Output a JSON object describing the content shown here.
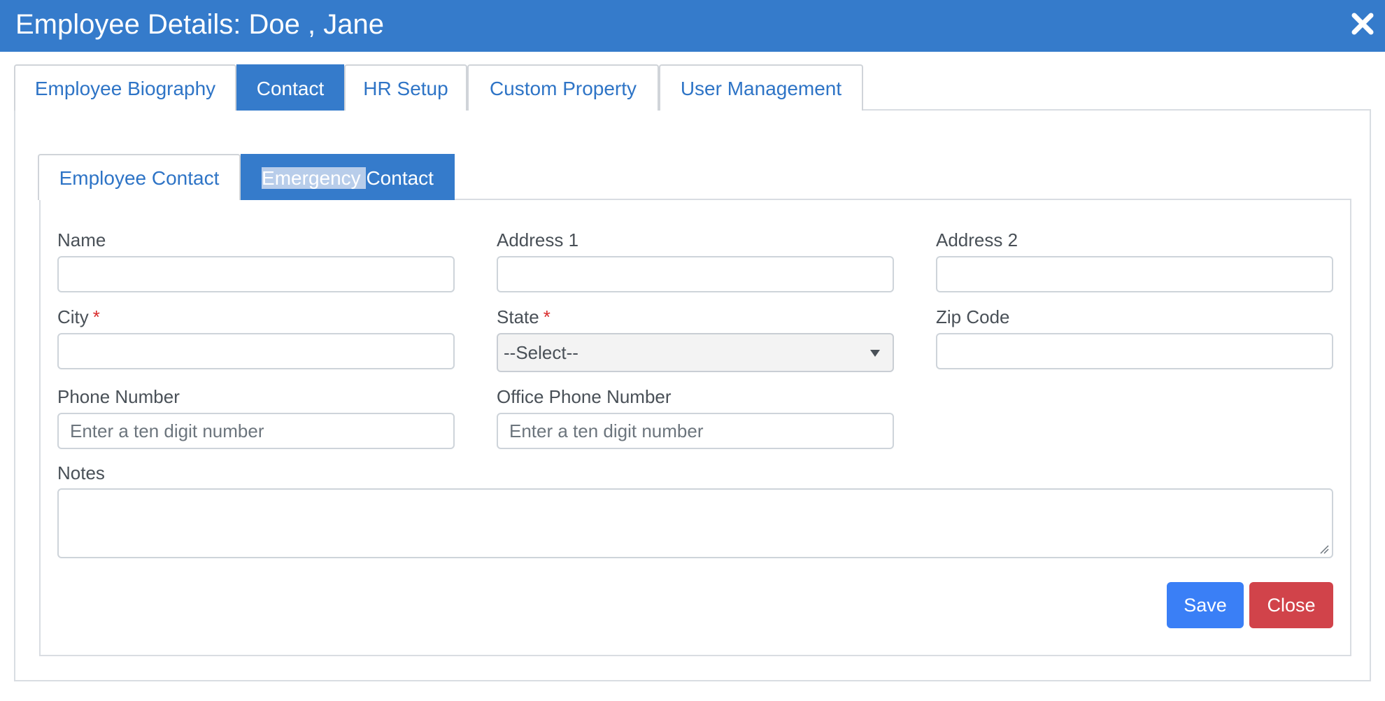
{
  "dialog": {
    "title": "Employee Details: Doe , Jane",
    "close_icon": "close-icon"
  },
  "tabs": [
    {
      "label": "Employee Biography",
      "active": false
    },
    {
      "label": "Contact",
      "active": true
    },
    {
      "label": "HR Setup",
      "active": false
    },
    {
      "label": "Custom Property",
      "active": false
    },
    {
      "label": "User Management",
      "active": false
    }
  ],
  "subtabs": [
    {
      "label": "Employee Contact",
      "active": false
    },
    {
      "label_selected_part": "Emergency ",
      "label_rest": "Contact",
      "active": true
    }
  ],
  "form": {
    "name_label": "Name",
    "name_value": "",
    "address1_label": "Address 1",
    "address1_value": "",
    "address2_label": "Address 2",
    "address2_value": "",
    "city_label": "City",
    "city_value": "",
    "required_marker": "*",
    "state_label": "State",
    "state_selected": "--Select--",
    "zip_label": "Zip Code",
    "zip_value": "",
    "phone_label": "Phone Number",
    "phone_placeholder": "Enter a ten digit number",
    "office_phone_label": "Office Phone Number",
    "office_phone_placeholder": "Enter a ten digit number",
    "notes_label": "Notes",
    "notes_value": ""
  },
  "actions": {
    "save_label": "Save",
    "close_label": "Close"
  },
  "colors": {
    "header": "#357bcb",
    "tab_text": "#2e74c6",
    "save": "#3a7ff6",
    "close": "#d1434a",
    "required": "#d92b2b"
  }
}
